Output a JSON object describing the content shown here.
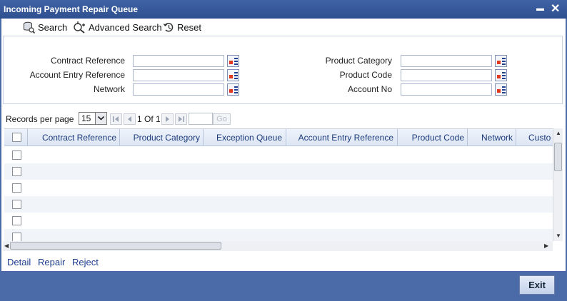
{
  "window": {
    "title": "Incoming Payment Repair Queue",
    "minimize_glyph": "▬",
    "close_glyph": "✕"
  },
  "toolbar": {
    "search_label": "Search",
    "advanced_search_label": "Advanced Search",
    "reset_label": "Reset"
  },
  "search_form": {
    "contract_reference_label": "Contract Reference",
    "account_entry_reference_label": "Account Entry Reference",
    "network_label": "Network",
    "product_category_label": "Product Category",
    "product_code_label": "Product Code",
    "account_no_label": "Account No",
    "contract_reference_value": "",
    "account_entry_reference_value": "",
    "network_value": "",
    "product_category_value": "",
    "product_code_value": "",
    "account_no_value": ""
  },
  "pager": {
    "records_per_page_label": "Records per page",
    "records_per_page_value": "15",
    "page_info": "1 Of 1",
    "go_label": "Go"
  },
  "grid": {
    "columns": [
      "Contract Reference",
      "Product Category",
      "Exception Queue",
      "Account Entry Reference",
      "Product Code",
      "Network",
      "Custo"
    ],
    "rows": []
  },
  "actions": {
    "detail_label": "Detail",
    "repair_label": "Repair",
    "reject_label": "Reject"
  },
  "footer": {
    "exit_label": "Exit"
  },
  "colors": {
    "title_bar": "#2f4f8f",
    "background": "#4a6aa8",
    "link": "#1f3f8f",
    "lov_icon_accent": "#e03a1e"
  }
}
